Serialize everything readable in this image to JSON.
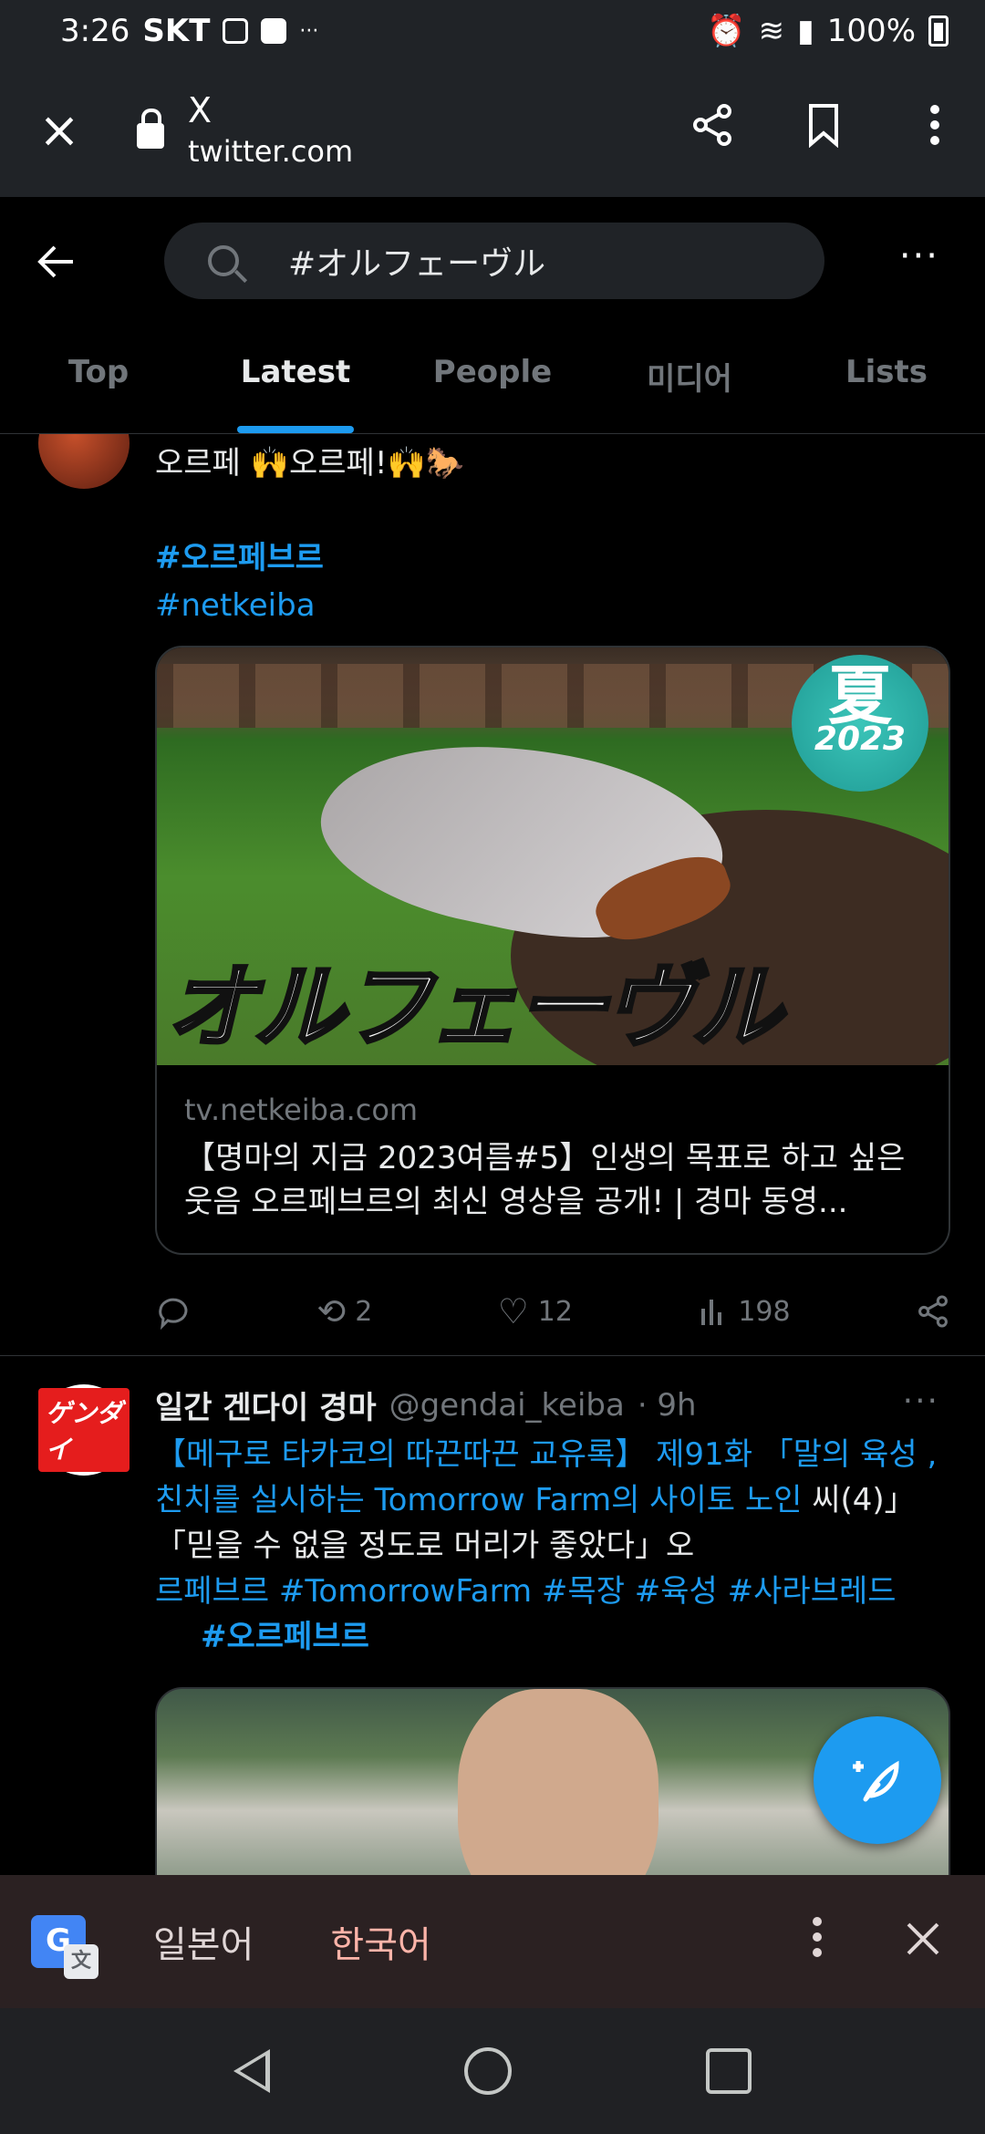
{
  "statusbar": {
    "time": "3:26",
    "carrier": "SKT",
    "extra": "···",
    "battery": "100%"
  },
  "browser": {
    "close_icon": "×",
    "title": "X",
    "host": "twitter.com"
  },
  "search": {
    "value": "#オルフェーヴル",
    "more": "···"
  },
  "tabs": [
    {
      "label": "Top"
    },
    {
      "label": "Latest"
    },
    {
      "label": "People"
    },
    {
      "label": "미디어"
    },
    {
      "label": "Lists"
    }
  ],
  "tweet1": {
    "line1": "오르페 🙌오르페!🙌🐎",
    "hashtag1": "#오르페브르",
    "hashtag2": "#netkeiba",
    "card": {
      "badge_kanji": "夏",
      "badge_year": "2023",
      "image_title": "オルフェーヴル",
      "domain": "tv.netkeiba.com",
      "title": "【명마의 지금 2023여름#5】인생의 목표로 하고 싶은 웃음 오르페브르의 최신 영상을 공개! | 경마 동영..."
    },
    "stats": {
      "retweets": "2",
      "likes": "12",
      "views": "198"
    }
  },
  "tweet2": {
    "avatar_text": "ゲンダイ",
    "name": "일간 겐다이 경마",
    "handle": "@gendai_keiba",
    "time": "· 9h",
    "more": "···",
    "part1": "【메구로 타카코의 따끈따끈 교유록】 제91화 「말의 육성 , 친치를 실시하는 Tomorrow Farm의 사이토 노인",
    "part2": " 씨(4)」 「믿을 수 없을 정도로 머리가 좋았다」오",
    "part3": "르페브르 #TomorrowFarm #목장 #육성 #사라브레드",
    "part4": "#오르페브르"
  },
  "translate": {
    "lang1": "일본어",
    "lang2": "한국어",
    "g_label": "G"
  },
  "colors": {
    "accent": "#1d9bf0",
    "background": "#000000",
    "translate_active": "#ffb4a9"
  }
}
